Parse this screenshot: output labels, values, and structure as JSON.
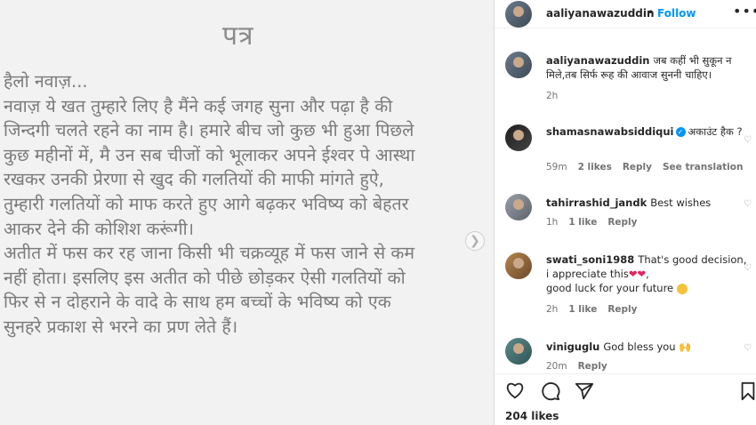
{
  "letter": {
    "title": "पत्र",
    "body": "हैलो नवाज़...\nनवाज़ ये खत तुम्हारे लिए है मैंने कई जगह सुना और पढ़ा है की\nजिन्दगी चलते रहने का नाम है। हमारे बीच जो कुछ भी हुआ पिछले\nकुछ महीनों में, मै उन सब चीजों को भूलाकर अपने ईश्वर पे आस्था\nरखकर उनकी प्रेरणा से खुद की गलतियों की माफी मांगते हुऐ,\nतुम्हारी गलतियों को माफ करते हुए आगे बढ़कर भविष्य को बेहतर\nआकर देने की कोशिश करूंगी।\nअतीत में फस कर रह जाना किसी भी चक्रव्यूह में फस जाने से कम\nनहीं होता।  इसलिए इस अतीत को पीछे छोड़कर ऐसी गलतियों को\nफिर से न दोहराने के वादे के साथ हम बच्चों के भविष्य को एक\nसुनहरे प्रकाश से भरने का प्रण लेते हैं।"
  },
  "header": {
    "username": "aaliyanawazuddin",
    "dot": "•",
    "follow": "Follow",
    "more_icon": "more-horizontal-icon"
  },
  "caption": {
    "username": "aaliyanawazuddin",
    "text": "जब कहीं भी सुकून न मिले,तब सिर्फ रूह की आवाज सुननी चाहिए।",
    "time": "2h"
  },
  "comments": [
    {
      "username": "shamasnawabsiddiqui",
      "verified": true,
      "text": "अकाउंट हैक ?",
      "time": "59m",
      "likes": "2 likes",
      "reply": "Reply",
      "translation": "See translation"
    },
    {
      "username": "tahirrashid_jandk",
      "text": "Best wishes",
      "time": "1h",
      "likes": "1 like",
      "reply": "Reply"
    },
    {
      "username": "swati_soni1988",
      "text": "That's good decision, i appreciate this",
      "text2": "good luck for your future",
      "time": "2h",
      "likes": "1 like",
      "reply": "Reply"
    },
    {
      "username": "viniguglu",
      "text": "God bless you",
      "time": "20m",
      "reply": "Reply"
    }
  ],
  "actions": {
    "likes": "204 likes"
  },
  "colors": {
    "accent": "#0095f6",
    "heart": "#e0245e"
  }
}
